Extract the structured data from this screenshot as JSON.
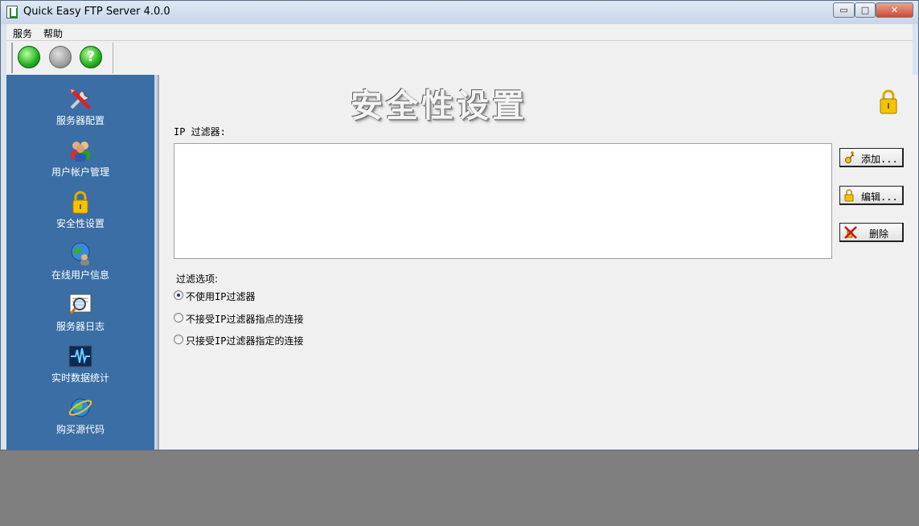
{
  "window": {
    "title": "Quick Easy FTP Server 4.0.0",
    "controls": {
      "minimize": "▭",
      "maximize": "□",
      "close": "✕"
    }
  },
  "menubar": {
    "items": [
      "服务",
      "帮助"
    ]
  },
  "toolbar": {
    "help_glyph": "?"
  },
  "sidebar": {
    "items": [
      {
        "label": "服务器配置",
        "icon": "tools-icon"
      },
      {
        "label": "用户帐户管理",
        "icon": "users-icon"
      },
      {
        "label": "安全性设置",
        "icon": "lock-icon"
      },
      {
        "label": "在线用户信息",
        "icon": "globe-users-icon"
      },
      {
        "label": "服务器日志",
        "icon": "log-search-icon"
      },
      {
        "label": "实时数据统计",
        "icon": "pulse-chart-icon"
      },
      {
        "label": "购买源代码",
        "icon": "internet-globe-icon"
      }
    ]
  },
  "main": {
    "heading": "安全性设置",
    "ip_filter_label": "IP 过滤器:",
    "buttons": {
      "add": "添加...",
      "edit": "编辑...",
      "delete": "删除"
    },
    "options_label": "过滤选项:",
    "options": [
      {
        "label": "不使用IP过滤器",
        "selected": true
      },
      {
        "label": "不接受IP过滤器指点的连接",
        "selected": false
      },
      {
        "label": "只接受IP过滤器指定的连接",
        "selected": false
      }
    ]
  },
  "colors": {
    "sidebar": "#3a6ea5",
    "content": "#f0f0f0",
    "titlebar": "#d0ddee",
    "desktop": "#7f7f7f"
  }
}
